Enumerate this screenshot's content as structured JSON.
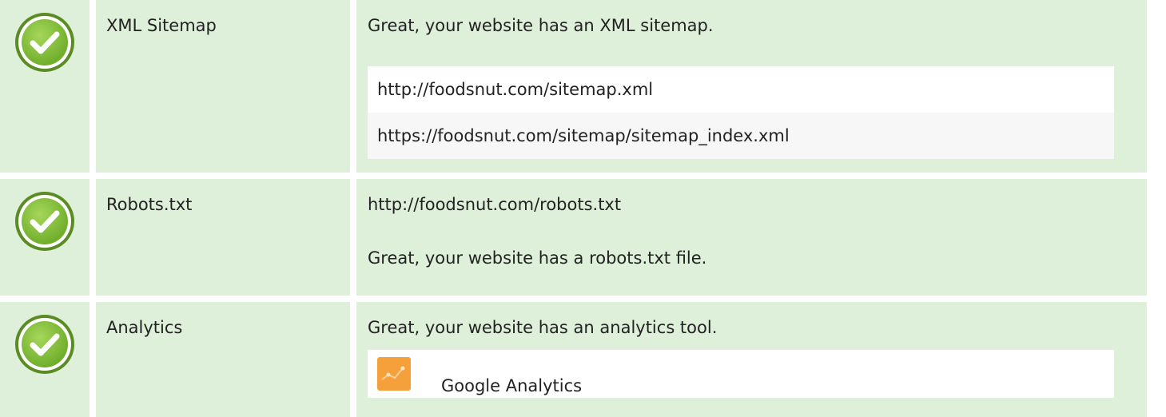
{
  "rows": [
    {
      "status": "pass",
      "name": "XML Sitemap",
      "message": "Great, your website has an XML sitemap.",
      "links": [
        "http://foodsnut.com/sitemap.xml",
        "https://foodsnut.com/sitemap/sitemap_index.xml"
      ]
    },
    {
      "status": "pass",
      "name": "Robots.txt",
      "url": "http://foodsnut.com/robots.txt",
      "message": "Great, your website has a robots.txt file."
    },
    {
      "status": "pass",
      "name": "Analytics",
      "message": "Great, your website has an analytics tool.",
      "tools": [
        {
          "label": "Google Analytics",
          "icon": "google-analytics-icon"
        }
      ]
    }
  ],
  "colors": {
    "row_background": "#def0da",
    "check_green": "#8cc63f",
    "check_dark": "#5b8c23",
    "analytics_orange": "#f6a03b"
  },
  "icons": {
    "status": "check-circle-icon",
    "analytics": "google-analytics-icon"
  }
}
